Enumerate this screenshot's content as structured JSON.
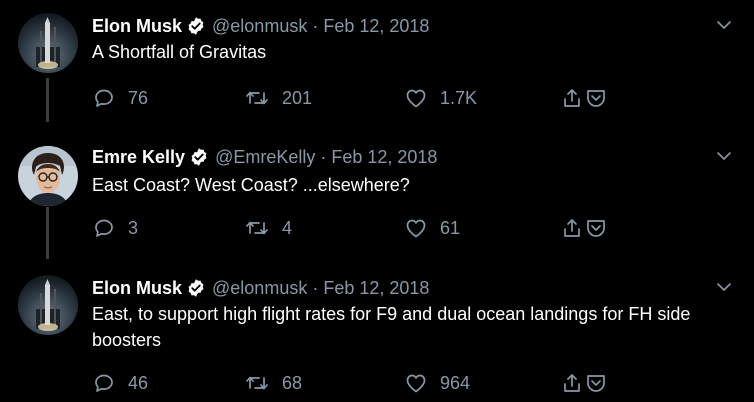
{
  "tweets": [
    {
      "display_name": "Elon Musk",
      "handle": "@elonmusk",
      "separator": "·",
      "date": "Feb 12, 2018",
      "text": "A Shortfall of Gravitas",
      "replies": "76",
      "retweets": "201",
      "likes": "1.7K",
      "avatar": "rocket-launch-icon"
    },
    {
      "display_name": "Emre Kelly",
      "handle": "@EmreKelly",
      "separator": "·",
      "date": "Feb 12, 2018",
      "text": "East Coast? West Coast? ...elsewhere?",
      "replies": "3",
      "retweets": "4",
      "likes": "61",
      "avatar": "person-photo"
    },
    {
      "display_name": "Elon Musk",
      "handle": "@elonmusk",
      "separator": "·",
      "date": "Feb 12, 2018",
      "text": "East, to support high flight rates for F9 and dual ocean landings for FH side boosters",
      "replies": "46",
      "retweets": "68",
      "likes": "964",
      "avatar": "rocket-launch-icon"
    }
  ],
  "colors": {
    "background": "#000000",
    "text": "#ffffff",
    "muted": "#8899a6",
    "verified": "#ffffff",
    "thread_line": "#3d3d3d"
  }
}
